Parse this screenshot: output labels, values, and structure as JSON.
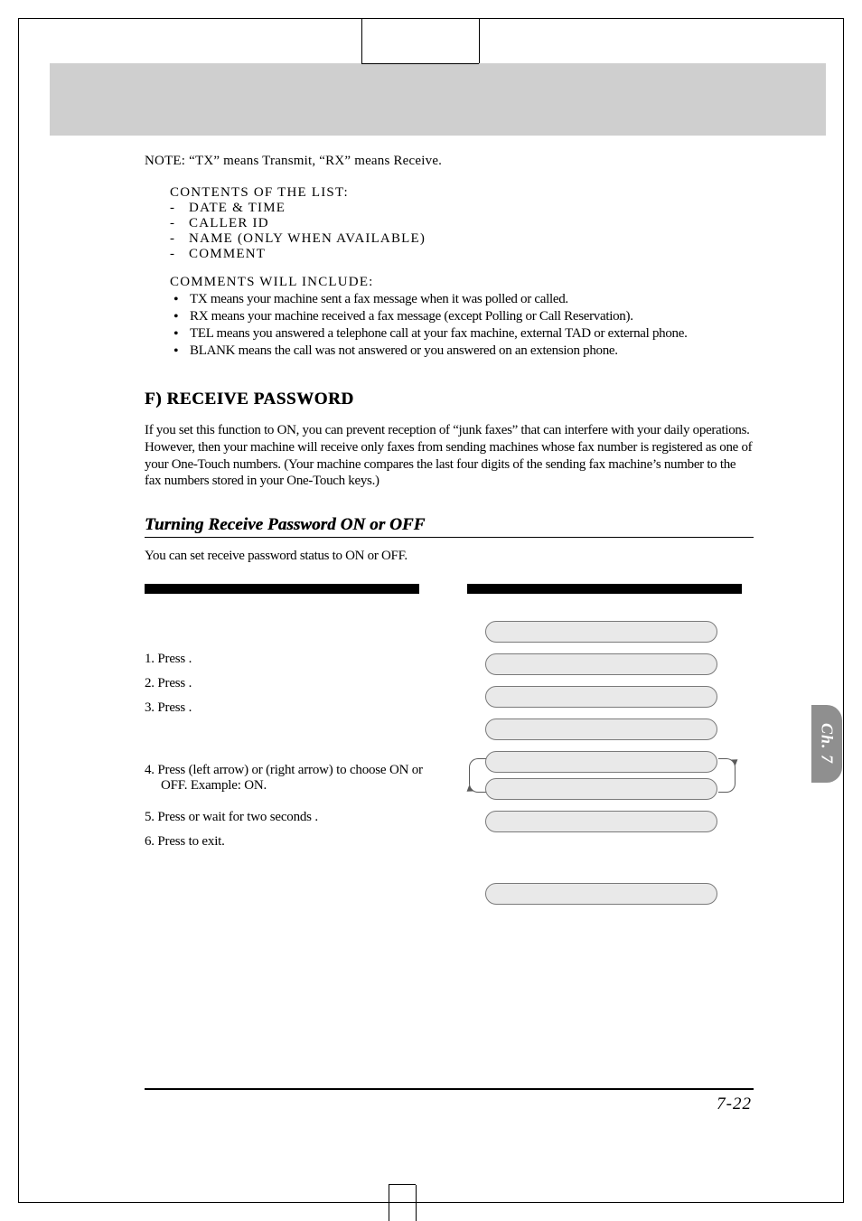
{
  "note": "NOTE: “TX” means Transmit, “RX” means Receive.",
  "contents": {
    "title": "CONTENTS  OF  THE  LIST:",
    "items": [
      "DATE  &  TIME",
      "CALLER  ID",
      "NAME  (ONLY  WHEN  AVAILABLE)",
      "COMMENT"
    ]
  },
  "comments": {
    "title": "COMMENTS  WILL  INCLUDE:",
    "items": [
      "TX means your machine sent a fax message when it was polled or called.",
      "RX means your machine received a fax message (except Polling or Call Reservation).",
      "TEL means you answered a telephone call at your fax machine, external TAD or external phone.",
      "BLANK means the call was not answered or you answered on an extension phone."
    ]
  },
  "sectionF": {
    "heading": "F) RECEIVE PASSWORD",
    "body": "If you set this function to ON, you can prevent reception of “junk faxes” that can interfere with your daily operations. However, then your machine will receive only faxes from sending machines whose fax number is registered as one of your One-Touch numbers. (Your machine compares the last four digits of the sending fax machine’s number to the fax numbers stored in your One-Touch keys.)"
  },
  "turning": {
    "heading": "Turning Receive Password ON or OFF",
    "intro": "You can set receive password status to ON or OFF.",
    "steps": [
      "1. Press             .",
      "2. Press   .",
      "3. Press   .",
      "4. Press     (left arrow)  or     (right arrow) to choose ON or OFF. Example: ON.",
      "5.  Press       or wait for two seconds .",
      "6.  Press        to exit."
    ]
  },
  "chapterTab": "Ch. 7",
  "pageNumber": "7-22"
}
